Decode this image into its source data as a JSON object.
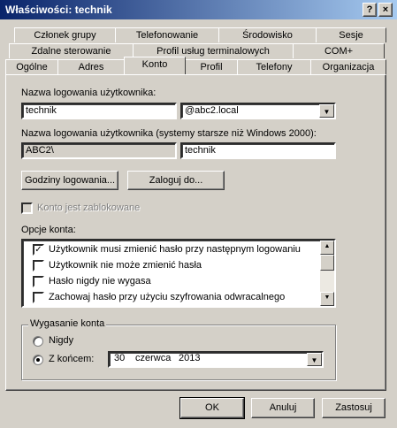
{
  "window": {
    "title": "Właściwości: technik",
    "help_label": "?",
    "close_label": "×"
  },
  "tabs": {
    "row1": [
      "Członek grupy",
      "Telefonowanie",
      "Środowisko",
      "Sesje"
    ],
    "row2": [
      "Zdalne sterowanie",
      "Profil usług terminalowych",
      "COM+"
    ],
    "row3": [
      "Ogólne",
      "Adres",
      "Konto",
      "Profil",
      "Telefony",
      "Organizacja"
    ],
    "selected": "Konto"
  },
  "account": {
    "logon_name_label": "Nazwa logowania użytkownika:",
    "logon_name_value": "technik",
    "domain_value": "@abc2.local",
    "legacy_label": "Nazwa logowania użytkownika (systemy starsze niż Windows 2000):",
    "legacy_domain_value": "ABC2\\",
    "legacy_name_value": "technik",
    "logon_hours_button": "Godziny logowania...",
    "logon_to_button": "Zaloguj do...",
    "locked_label": "Konto jest zablokowane"
  },
  "options": {
    "label": "Opcje konta:",
    "items": [
      {
        "label": "Użytkownik musi zmienić hasło przy następnym logowaniu",
        "checked": true
      },
      {
        "label": "Użytkownik nie może zmienić hasła",
        "checked": false
      },
      {
        "label": "Hasło nigdy nie wygasa",
        "checked": false
      },
      {
        "label": "Zachowaj hasło przy użyciu szyfrowania odwracalnego",
        "checked": false
      }
    ]
  },
  "expiration": {
    "label": "Wygasanie konta",
    "never_label": "Nigdy",
    "end_label": "Z końcem:",
    "end_selected": true,
    "date_day": "30",
    "date_month": "czerwca",
    "date_year": "2013"
  },
  "footer": {
    "ok": "OK",
    "cancel": "Anuluj",
    "apply": "Zastosuj"
  },
  "icons": {
    "check": "✓",
    "dropdown": "▼",
    "up": "▲",
    "down": "▼"
  }
}
